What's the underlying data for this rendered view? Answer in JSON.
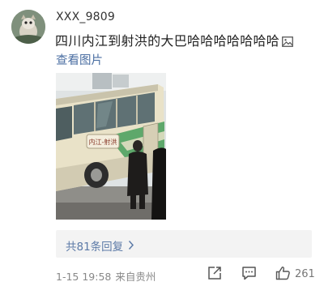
{
  "post": {
    "username": "XXX_9809",
    "text": "四川内江到射洪的大巴哈哈哈哈哈哈哈",
    "view_pictures": "查看图片",
    "bus_sign": "内江-射洪"
  },
  "comments": {
    "label": "共81条回复"
  },
  "meta": {
    "timestamp": "1-15 19:58",
    "location": "来自贵州",
    "like_count": "261"
  },
  "icons": {
    "text_image": "image-icon",
    "share": "share-icon",
    "comment": "comment-icon",
    "like": "thumbs-up-icon",
    "chevron": "chevron-right-icon"
  },
  "colors": {
    "link": "#4a6ea2",
    "comment_link": "#5c7aa7",
    "meta": "#888888",
    "comment_bg": "#f3f3f3"
  }
}
